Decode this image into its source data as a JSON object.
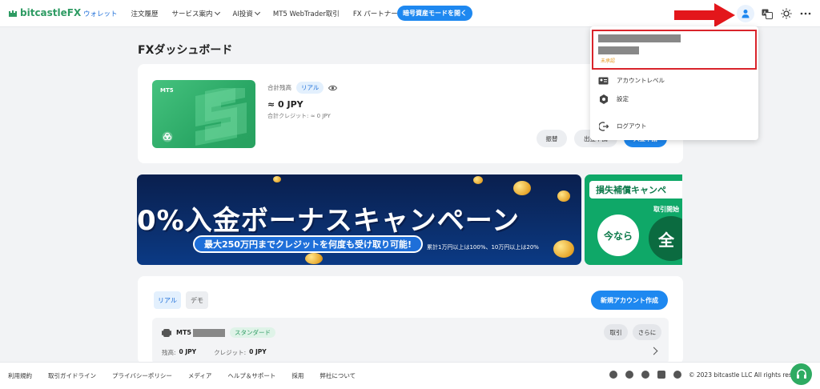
{
  "header": {
    "logo_text": "bitcastle",
    "logo_fx": "FX",
    "nav": [
      {
        "label": "ウォレット",
        "active": true
      },
      {
        "label": "注文履歴"
      },
      {
        "label": "サービス案内",
        "dropdown": true
      },
      {
        "label": "AI投資",
        "dropdown": true
      },
      {
        "label": "MT5 WebTrader取引"
      },
      {
        "label": "FX パートナー"
      }
    ],
    "crypto_button": "暗号資産モードを開く"
  },
  "user_menu": {
    "status": "未承認",
    "items": [
      {
        "label": "アカウントレベル",
        "icon": "id-card-icon"
      },
      {
        "label": "設定",
        "icon": "gear-icon"
      },
      {
        "label": "ログアウト",
        "icon": "logout-icon"
      }
    ]
  },
  "dashboard": {
    "title": "FXダッシュボード",
    "tile_label": "MT5",
    "balance_label": "合計残高",
    "balance_badge": "リアル",
    "balance_value": "≈ 0 JPY",
    "credit_line": "合計クレジット: ≈ 0 JPY",
    "buttons": {
      "transfer": "振替",
      "withdraw": "出金申請",
      "deposit": "入金申請"
    }
  },
  "banner": {
    "title": "0%入金ボーナスキャンペーン",
    "subtitle": "最大250万円までクレジットを何度も受け取り可能!",
    "note": "累計1万円以上は100%、10万円以上は20%"
  },
  "banner2": {
    "heading": "損失補償キャンペ",
    "sub": "取引開始",
    "now": "今なら",
    "all": "全"
  },
  "accounts": {
    "tabs": {
      "real": "リアル",
      "demo": "デモ"
    },
    "new_button": "新規アカウント作成",
    "row": {
      "name_prefix": "MT5",
      "type_badge": "スタンダード",
      "trade_button": "取引",
      "more_button": "さらに",
      "balance_label": "残高:",
      "balance_value": "0 JPY",
      "credit_label": "クレジット:",
      "credit_value": "0 JPY"
    }
  },
  "footer": {
    "links": [
      "利用規約",
      "取引ガイドライン",
      "プライバシーポリシー",
      "メディア",
      "ヘルプ＆サポート",
      "採用",
      "弊社について"
    ],
    "copyright": "© 2023 bitcastle LLC All rights res"
  },
  "colors": {
    "accent": "#1e88f0",
    "brand_green": "#2e9b63",
    "highlight_red": "#d9242b"
  }
}
